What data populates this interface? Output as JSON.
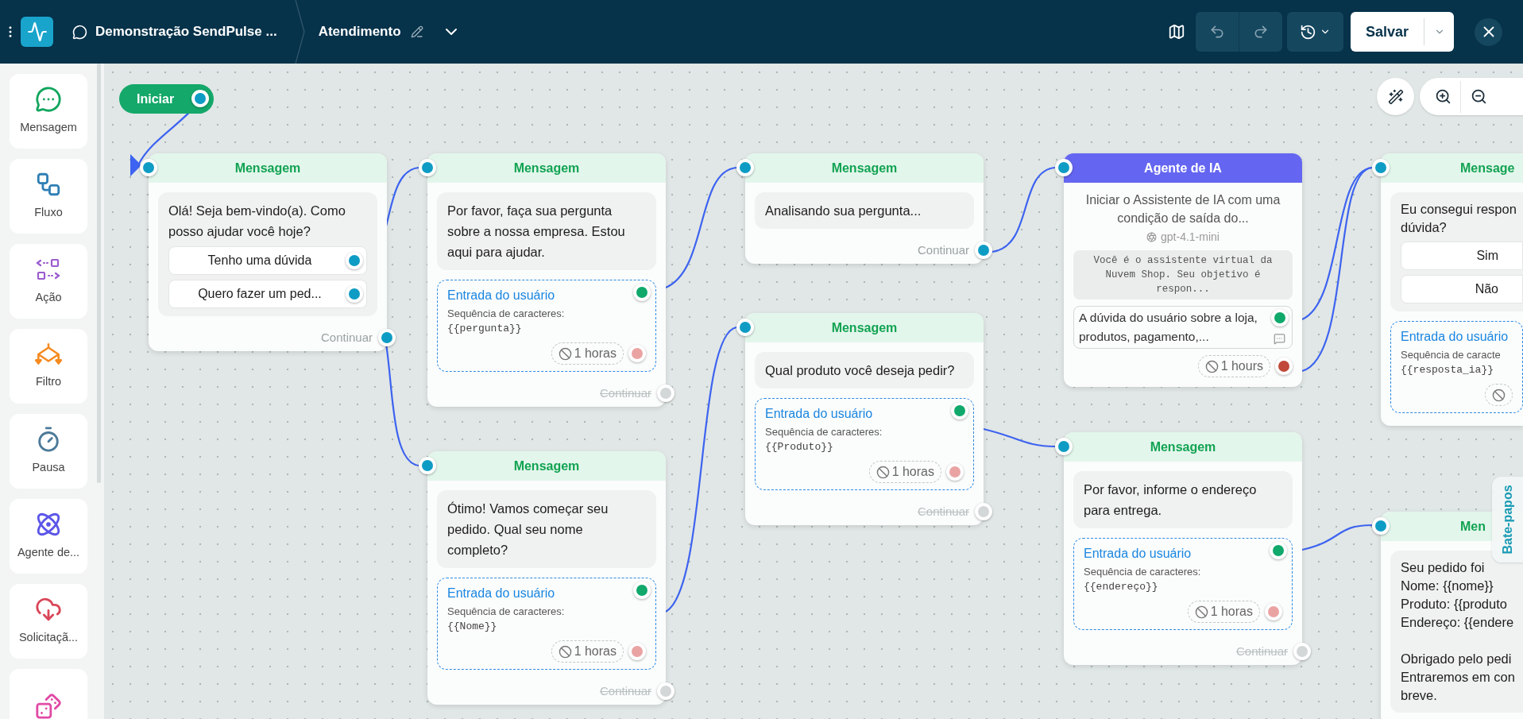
{
  "header": {
    "bot_name": "Demonstração SendPulse ...",
    "flow_name": "Atendimento",
    "save_label": "Salvar"
  },
  "sidebar": [
    {
      "kind": "message",
      "label": "Mensagem"
    },
    {
      "kind": "flow",
      "label": "Fluxo"
    },
    {
      "kind": "action",
      "label": "Ação"
    },
    {
      "kind": "filter",
      "label": "Filtro"
    },
    {
      "kind": "pause",
      "label": "Pausa"
    },
    {
      "kind": "ai_agent",
      "label": "Agente de..."
    },
    {
      "kind": "request",
      "label": "Solicitaçã..."
    },
    {
      "kind": "random"
    }
  ],
  "canvas": {
    "start_label": "Iniciar",
    "side_tab": "Bate-papos",
    "nodes": [
      {
        "kind": "message",
        "clipped": false,
        "title": "Mensagem",
        "text": "Olá! Seja bem-vindo(a). Como posso ajudar você hoje?",
        "buttons": [
          "Tenho uma dúvida",
          "Quero fazer um ped..."
        ],
        "continue": {
          "label": "Continuar",
          "enabled": true
        }
      },
      {
        "kind": "message",
        "clipped": false,
        "title": "Mensagem",
        "text": "Por favor, faça sua pergunta sobre a nossa empresa. Estou aqui para ajudar.",
        "input": {
          "label": "Entrada do usuário",
          "type_label": "Sequência de caracteres:",
          "variable": "{{pergunta}}",
          "timeout": {
            "label": "1 horas",
            "active": false
          }
        },
        "continue": {
          "label": "Continuar",
          "enabled": false
        }
      },
      {
        "kind": "message",
        "clipped": false,
        "title": "Mensagem",
        "text": "Ótimo! Vamos começar seu pedido. Qual seu nome completo?",
        "input": {
          "label": "Entrada do usuário",
          "type_label": "Sequência de caracteres:",
          "variable": "{{Nome}}",
          "timeout": {
            "label": "1 horas",
            "active": false
          }
        },
        "continue": {
          "label": "Continuar",
          "enabled": false
        }
      },
      {
        "kind": "message",
        "clipped": false,
        "title": "Mensagem",
        "text": "Analisando sua pergunta...",
        "continue": {
          "label": "Continuar",
          "enabled": true
        }
      },
      {
        "kind": "message",
        "clipped": false,
        "title": "Mensagem",
        "text": "Qual produto você deseja pedir?",
        "input": {
          "label": "Entrada do usuário",
          "type_label": "Sequência de caracteres:",
          "variable": "{{Produto}}",
          "timeout": {
            "label": "1 horas",
            "active": false
          }
        },
        "continue": {
          "label": "Continuar",
          "enabled": false
        }
      },
      {
        "kind": "ai_agent",
        "title": "Agente de IA",
        "description": "Iniciar o Assistente de IA com uma condição de saída do...",
        "model": "gpt-4.1-mini",
        "prompt": "Você é o assistente virtual da Nuvem Shop. Seu objetivo é respon...",
        "exit_condition": "A dúvida do usuário sobre a loja, produtos, pagamento,...",
        "timeout": {
          "label": "1 hours",
          "active": true
        }
      },
      {
        "kind": "message",
        "clipped": false,
        "title": "Mensagem",
        "text": "Por favor, informe o endereço para entrega.",
        "input": {
          "label": "Entrada do usuário",
          "type_label": "Sequência de caracteres:",
          "variable": "{{endereço}}",
          "timeout": {
            "label": "1 horas",
            "active": false
          }
        },
        "continue": {
          "label": "Continuar",
          "enabled": false
        }
      },
      {
        "kind": "message",
        "clipped": true,
        "title": "Mensage",
        "text": "Eu consegui respon\ndúvida?",
        "buttons": [
          "Sim",
          "Não"
        ],
        "input": {
          "label": "Entrada do usuário",
          "type_label": "Sequência de caracte",
          "variable": "{{resposta_ia}}",
          "timeout": {
            "icon_only": true
          }
        }
      },
      {
        "kind": "message",
        "clipped": true,
        "title": "Men",
        "text": "Seu pedido foi\nNome: {{nome}}\nProduto: {{produto\nEndereço: {{endere\n\nObrigado pelo pedi\nEntraremos em con\nbreve."
      }
    ]
  }
}
